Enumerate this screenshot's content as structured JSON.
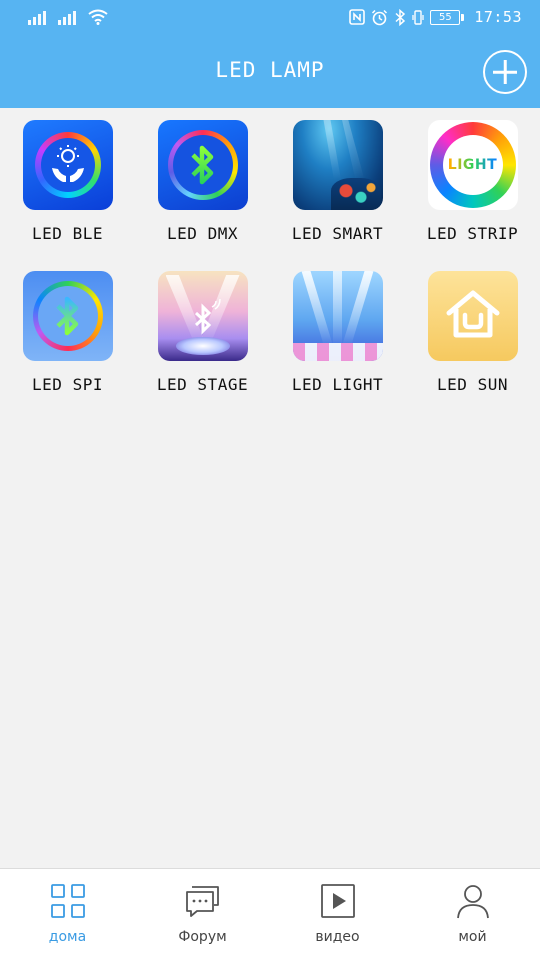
{
  "status_bar": {
    "time": "17:53",
    "battery": "55"
  },
  "header": {
    "title": "LED LAMP"
  },
  "apps": [
    {
      "label": "LED BLE",
      "icon": "sun-hands-icon"
    },
    {
      "label": "LED DMX",
      "icon": "bluetooth-rainbow-icon"
    },
    {
      "label": "LED SMART",
      "icon": "underwater-icon"
    },
    {
      "label": "LED STRIP",
      "icon": "light-color-wheel-icon"
    },
    {
      "label": "LED SPI",
      "icon": "bluetooth-ring-icon"
    },
    {
      "label": "LED STAGE",
      "icon": "stage-bluetooth-icon"
    },
    {
      "label": "LED LIGHT",
      "icon": "stage-lights-icon"
    },
    {
      "label": "LED SUN",
      "icon": "house-icon"
    }
  ],
  "light_text": "LIGHT",
  "bottom_nav": [
    {
      "label": "дома",
      "icon": "grid-icon",
      "active": true
    },
    {
      "label": "Форум",
      "icon": "chat-icon",
      "active": false
    },
    {
      "label": "видео",
      "icon": "play-icon",
      "active": false
    },
    {
      "label": "мой",
      "icon": "person-icon",
      "active": false
    }
  ],
  "colors": {
    "accent": "#57b4f2",
    "active_nav": "#3a9be3",
    "background": "#f2f2f2"
  }
}
